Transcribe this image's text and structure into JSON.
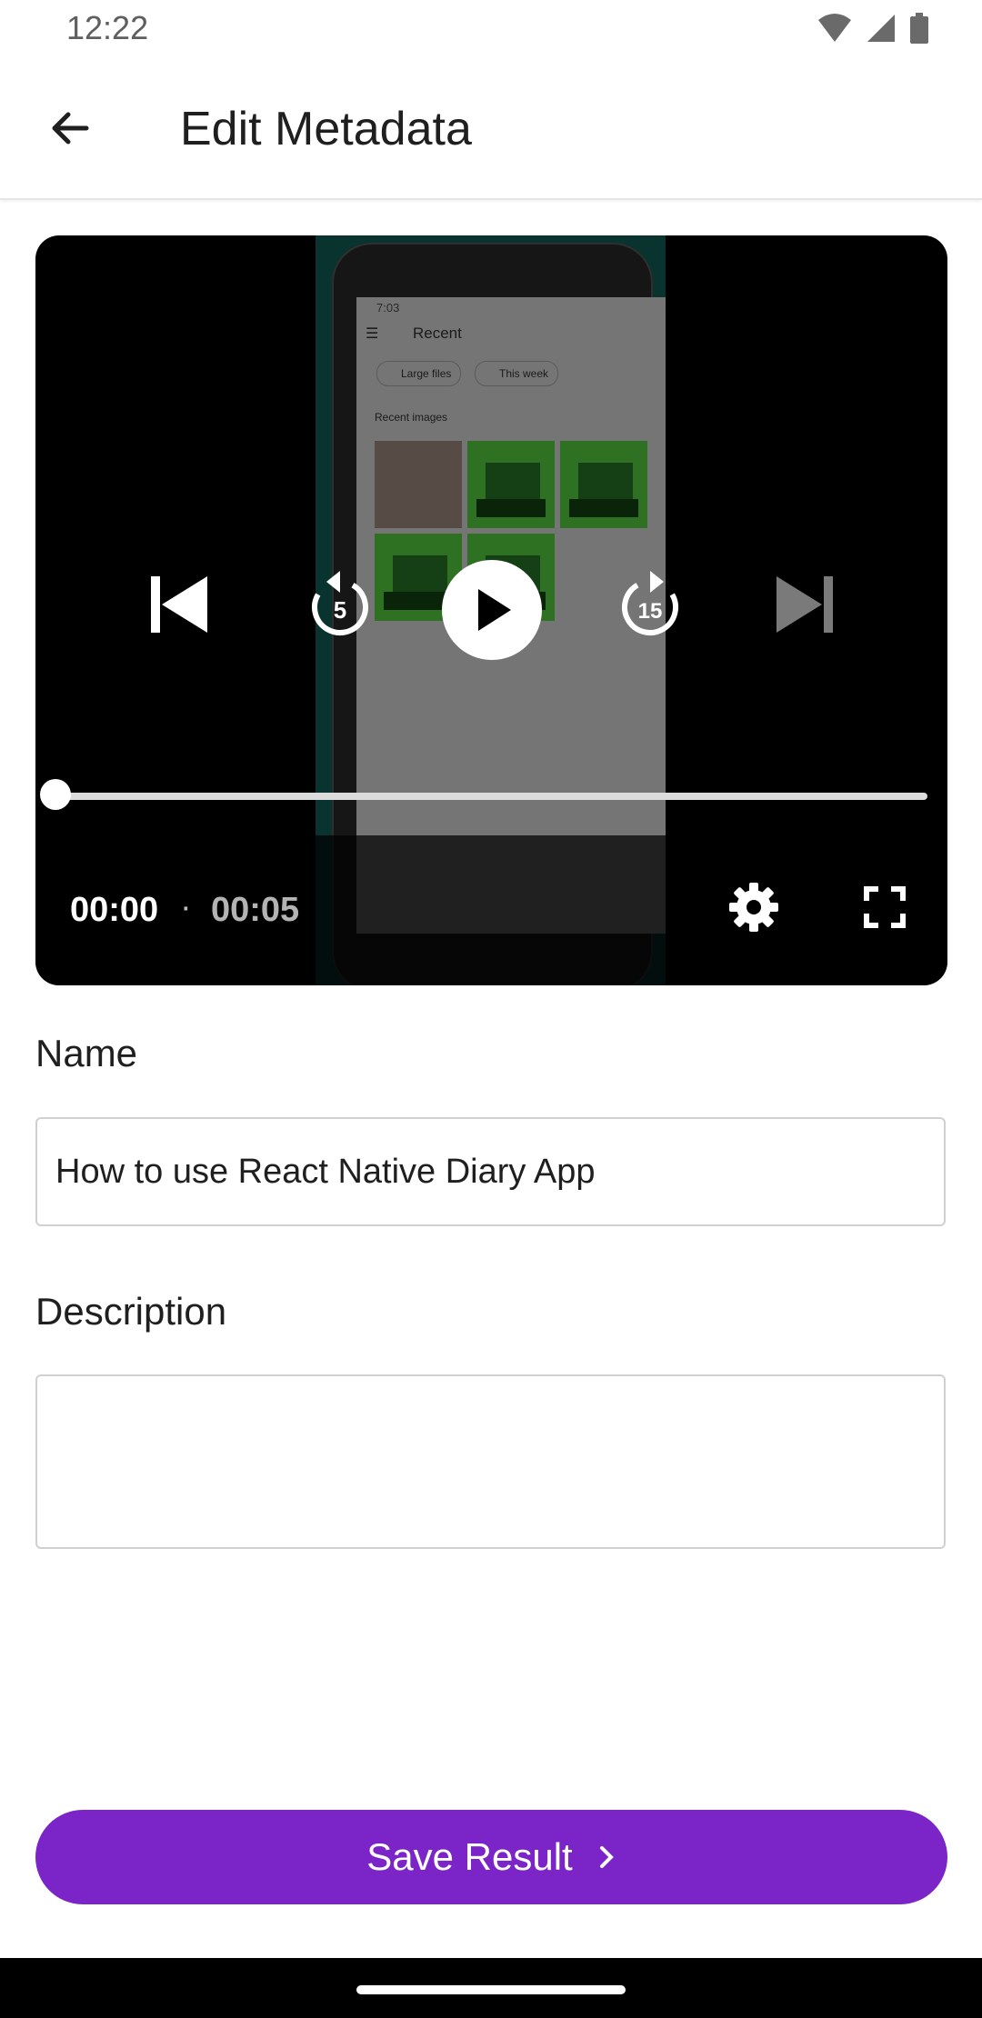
{
  "status_bar": {
    "time": "12:22"
  },
  "app_bar": {
    "title": "Edit Metadata"
  },
  "video_player": {
    "time_current": "00:00",
    "time_separator": "·",
    "time_total": "00:05",
    "progress": 0.0,
    "rewind_seconds": "5",
    "forward_seconds": "15",
    "preview": {
      "status_time": "7:03",
      "title": "Recent",
      "chips": [
        "Large files",
        "This week"
      ],
      "section": "Recent images"
    }
  },
  "form": {
    "name_label": "Name",
    "name_value": "How to use React Native Diary App",
    "description_label": "Description",
    "description_value": ""
  },
  "actions": {
    "save_label": "Save Result",
    "save_icon": "chevron-right-icon"
  },
  "colors": {
    "accent": "#7b25c9",
    "player_bg": "#000000"
  }
}
